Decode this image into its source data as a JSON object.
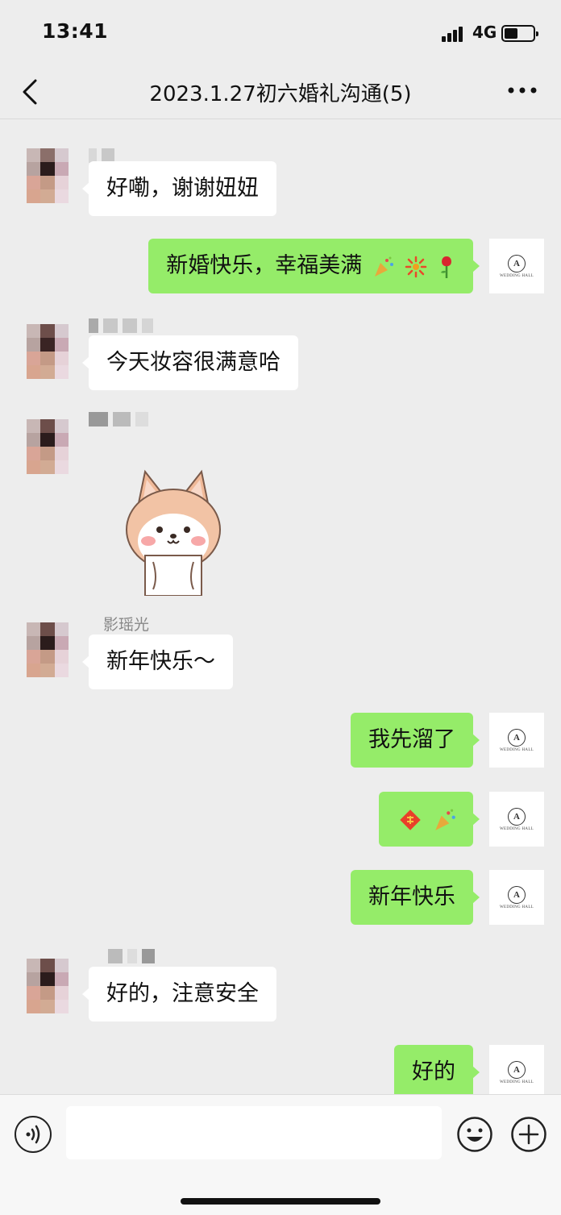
{
  "status_bar": {
    "time": "13:41",
    "network": "4G"
  },
  "nav": {
    "title": "2023.1.27初六婚礼沟通(5)"
  },
  "messages": [
    {
      "side": "left",
      "text": "好嘞，谢谢妞妞"
    },
    {
      "side": "right",
      "text": "新婚快乐，幸福美满",
      "emojis": [
        "party-popper",
        "fireworks",
        "rose"
      ]
    },
    {
      "side": "left",
      "text": "今天妆容很满意哈"
    },
    {
      "side": "left",
      "type": "sticker",
      "sticker": "shiba-dog"
    },
    {
      "side": "left",
      "sender": "影瑶光",
      "text": "新年快乐～"
    },
    {
      "side": "right",
      "text": "我先溜了"
    },
    {
      "side": "right",
      "type": "emoji",
      "emojis": [
        "fu-blessing",
        "party-popper"
      ]
    },
    {
      "side": "right",
      "text": "新年快乐"
    },
    {
      "side": "left",
      "text": "好的，注意安全"
    },
    {
      "side": "right",
      "text": "好的"
    }
  ],
  "self_avatar": {
    "logo_letter": "A",
    "logo_text": "WEDDING HALL"
  },
  "colors": {
    "self_bubble": "#95ec69",
    "other_bubble": "#ffffff",
    "background": "#ededed"
  },
  "input_bar": {
    "value": ""
  }
}
